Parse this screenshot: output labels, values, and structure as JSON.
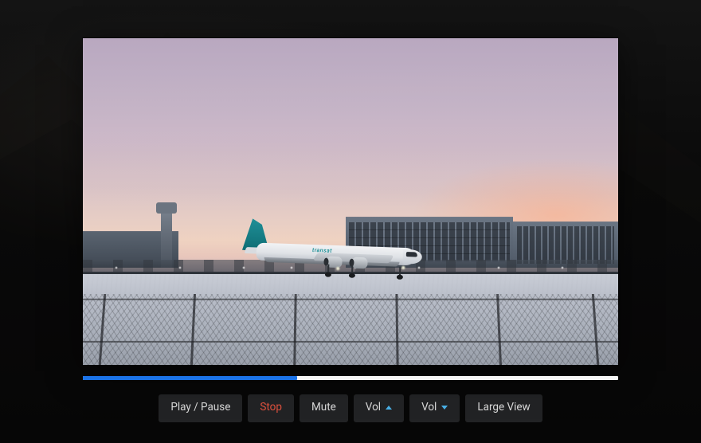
{
  "video": {
    "livery_text": "transat",
    "progress_percent": 40
  },
  "controls": {
    "play_pause_label": "Play / Pause",
    "stop_label": "Stop",
    "mute_label": "Mute",
    "vol_up_label": "Vol",
    "vol_down_label": "Vol",
    "large_view_label": "Large View"
  },
  "colors": {
    "accent": "#1b73e8",
    "stop": "#e0513e",
    "caret": "#49b0e6",
    "button_bg": "#222325"
  }
}
